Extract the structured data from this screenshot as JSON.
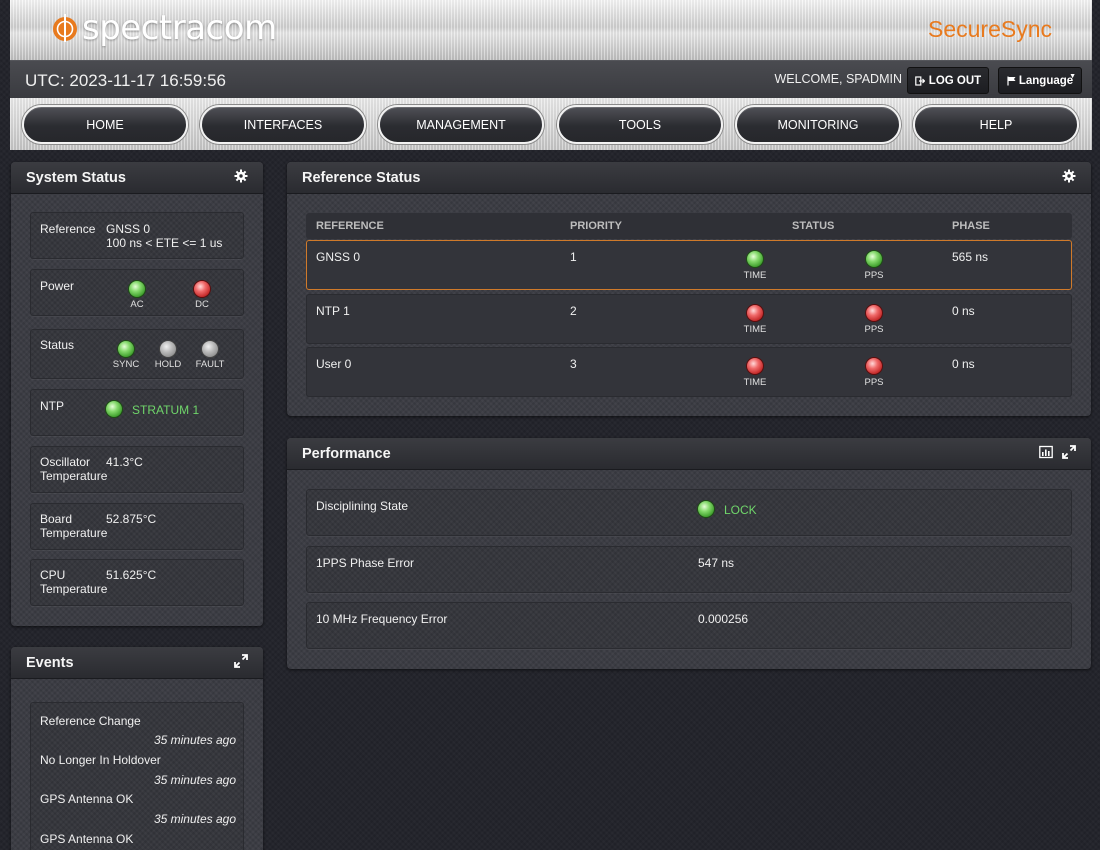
{
  "header": {
    "logo_text": "spectracom",
    "product_name": "SecureSync",
    "utc_label": "UTC: 2023-11-17 16:59:56",
    "welcome": "WELCOME, SPADMIN",
    "logout_label": "LOG OUT",
    "language_label": "Language"
  },
  "nav": [
    "HOME",
    "INTERFACES",
    "MANAGEMENT",
    "TOOLS",
    "MONITORING",
    "HELP"
  ],
  "system_status": {
    "title": "System Status",
    "reference": {
      "label": "Reference",
      "value": "GNSS 0",
      "detail": "100 ns < ETE <= 1 us"
    },
    "power": {
      "label": "Power",
      "ac": "AC",
      "dc": "DC"
    },
    "status": {
      "label": "Status",
      "sync": "SYNC",
      "hold": "HOLD",
      "fault": "FAULT"
    },
    "ntp": {
      "label": "NTP",
      "value": "STRATUM 1"
    },
    "oscillator": {
      "label_1": "Oscillator",
      "label_2": "Temperature",
      "value": "41.3°C"
    },
    "board": {
      "label_1": "Board",
      "label_2": "Temperature",
      "value": "52.875°C"
    },
    "cpu": {
      "label_1": "CPU",
      "label_2": "Temperature",
      "value": "51.625°C"
    }
  },
  "events": {
    "title": "Events",
    "items": [
      {
        "name": "Reference Change",
        "time": "35 minutes ago"
      },
      {
        "name": "No Longer In Holdover",
        "time": "35 minutes ago"
      },
      {
        "name": "GPS Antenna OK",
        "time": "35 minutes ago"
      },
      {
        "name": "GPS Antenna OK",
        "time": ""
      }
    ]
  },
  "reference_status": {
    "title": "Reference Status",
    "columns": [
      "REFERENCE",
      "PRIORITY",
      "STATUS",
      "PHASE"
    ],
    "time_label": "TIME",
    "pps_label": "PPS",
    "rows": [
      {
        "reference": "GNSS 0",
        "priority": "1",
        "time_state": "green",
        "pps_state": "green",
        "phase": "565 ns"
      },
      {
        "reference": "NTP 1",
        "priority": "2",
        "time_state": "red",
        "pps_state": "red",
        "phase": "0 ns"
      },
      {
        "reference": "User 0",
        "priority": "3",
        "time_state": "red",
        "pps_state": "red",
        "phase": "0 ns"
      }
    ]
  },
  "performance": {
    "title": "Performance",
    "disciplining_label": "Disciplining State",
    "disciplining_value": "LOCK",
    "pps_error_label": "1PPS Phase Error",
    "pps_error_value": "547 ns",
    "freq_error_label": "10 MHz Frequency Error",
    "freq_error_value": "0.000256"
  },
  "colors": {
    "accent": "#e87a1e",
    "ok": "#6fd56a",
    "alarm": "#d93030"
  }
}
